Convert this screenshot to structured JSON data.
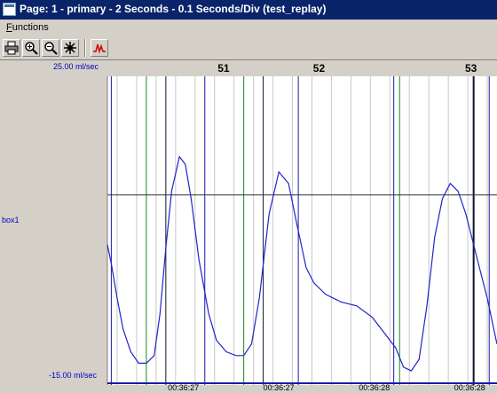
{
  "window": {
    "title": "Page: 1 - primary - 2 Seconds - 0.1 Seconds/Div (test_replay)"
  },
  "menu": {
    "functions_label": "Functions"
  },
  "toolbar": {
    "buttons": [
      {
        "icon": "printer-icon"
      },
      {
        "icon": "zoom-in-icon"
      },
      {
        "icon": "zoom-out-icon"
      },
      {
        "icon": "settings-icon"
      },
      {
        "icon": "waveform-icon"
      }
    ]
  },
  "chart_data": {
    "type": "line",
    "ylabels": {
      "top": "25.00 ml/sec",
      "bottom": "-15.00 ml/sec"
    },
    "channel_label": "box1",
    "ylim": [
      -15,
      25
    ],
    "xlim": [
      0,
      2
    ],
    "threshold": 9.5,
    "beats": [
      {
        "label": "51",
        "x": 0.61
      },
      {
        "label": "52",
        "x": 1.1
      },
      {
        "label": "53",
        "x": 1.88
      }
    ],
    "time_labels": [
      {
        "label": "00:36:27",
        "x": 0.39
      },
      {
        "label": "00:36:27",
        "x": 0.88
      },
      {
        "label": "00:36:28",
        "x": 1.37
      },
      {
        "label": "00:36:28",
        "x": 1.86
      }
    ],
    "gridlines_light": [
      0.05,
      0.15,
      0.25,
      0.35,
      0.45,
      0.55,
      0.65,
      0.75,
      0.85,
      0.95,
      1.05,
      1.15,
      1.25,
      1.35,
      1.45,
      1.55,
      1.65,
      1.75,
      1.85,
      1.95
    ],
    "markers_blue": [
      0.02,
      0.5,
      0.98,
      1.47,
      1.96
    ],
    "markers_green": [
      0.2,
      0.7,
      1.5
    ],
    "markers_dark": [
      0.3,
      0.8,
      1.88
    ],
    "series": [
      {
        "color": "#2222cc",
        "x": [
          0,
          0.02,
          0.05,
          0.08,
          0.12,
          0.16,
          0.2,
          0.24,
          0.27,
          0.3,
          0.33,
          0.37,
          0.4,
          0.43,
          0.47,
          0.52,
          0.56,
          0.61,
          0.66,
          0.7,
          0.74,
          0.78,
          0.83,
          0.88,
          0.93,
          0.97,
          1.02,
          1.06,
          1.12,
          1.2,
          1.28,
          1.36,
          1.42,
          1.48,
          1.52,
          1.56,
          1.6,
          1.64,
          1.68,
          1.72,
          1.76,
          1.8,
          1.84,
          1.9,
          1.95,
          2.0
        ],
        "y": [
          3,
          0.5,
          -4,
          -8,
          -11,
          -12.5,
          -12.5,
          -11.5,
          -6,
          2.5,
          10,
          14.5,
          13.5,
          9,
          1,
          -6,
          -9.5,
          -11,
          -11.5,
          -11.5,
          -10,
          -4,
          7,
          12.5,
          11,
          6,
          0,
          -2,
          -3.5,
          -4.5,
          -5,
          -6.5,
          -8.5,
          -10.5,
          -13,
          -13.5,
          -12,
          -5,
          4,
          9,
          11,
          10,
          7,
          1,
          -4,
          -10
        ]
      }
    ]
  }
}
